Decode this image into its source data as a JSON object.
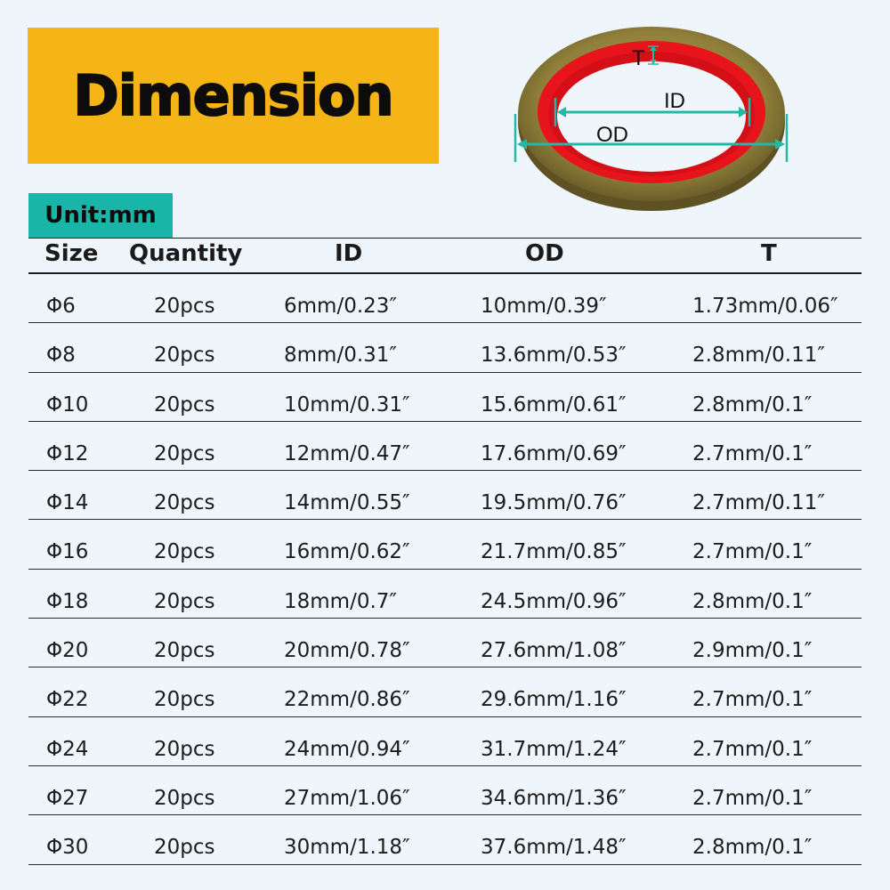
{
  "banner": {
    "title": "Dimension"
  },
  "diagram": {
    "label_t": "T",
    "label_id": "ID",
    "label_od": "OD"
  },
  "unit": {
    "label": "Unit:mm"
  },
  "table": {
    "headers": [
      "Size",
      "Quantity",
      "ID",
      "OD",
      "T"
    ],
    "rows": [
      [
        "Φ6",
        "20pcs",
        "6mm/0.23″",
        "10mm/0.39″",
        "1.73mm/0.06″"
      ],
      [
        "Φ8",
        "20pcs",
        "8mm/0.31″",
        "13.6mm/0.53″",
        "2.8mm/0.11″"
      ],
      [
        "Φ10",
        "20pcs",
        "10mm/0.31″",
        "15.6mm/0.61″",
        "2.8mm/0.1″"
      ],
      [
        "Φ12",
        "20pcs",
        "12mm/0.47″",
        "17.6mm/0.69″",
        "2.7mm/0.1″"
      ],
      [
        "Φ14",
        "20pcs",
        "14mm/0.55″",
        "19.5mm/0.76″",
        "2.7mm/0.11″"
      ],
      [
        "Φ16",
        "20pcs",
        "16mm/0.62″",
        "21.7mm/0.85″",
        "2.7mm/0.1″"
      ],
      [
        "Φ18",
        "20pcs",
        "18mm/0.7″",
        "24.5mm/0.96″",
        "2.8mm/0.1″"
      ],
      [
        "Φ20",
        "20pcs",
        "20mm/0.78″",
        "27.6mm/1.08″",
        "2.9mm/0.1″"
      ],
      [
        "Φ22",
        "20pcs",
        "22mm/0.86″",
        "29.6mm/1.16″",
        "2.7mm/0.1″"
      ],
      [
        "Φ24",
        "20pcs",
        "24mm/0.94″",
        "31.7mm/1.24″",
        "2.7mm/0.1″"
      ],
      [
        "Φ27",
        "20pcs",
        "27mm/1.06″",
        "34.6mm/1.36″",
        "2.7mm/0.1″"
      ],
      [
        "Φ30",
        "20pcs",
        "30mm/1.18″",
        "37.6mm/1.48″",
        "2.8mm/0.1″"
      ]
    ]
  },
  "colors": {
    "banner_bg": "#f6b516",
    "unit_bg": "#19b5a8",
    "washer_metal": "#8a7a34",
    "washer_seal": "#e8141c",
    "dimension_arrow": "#22b8a4"
  }
}
